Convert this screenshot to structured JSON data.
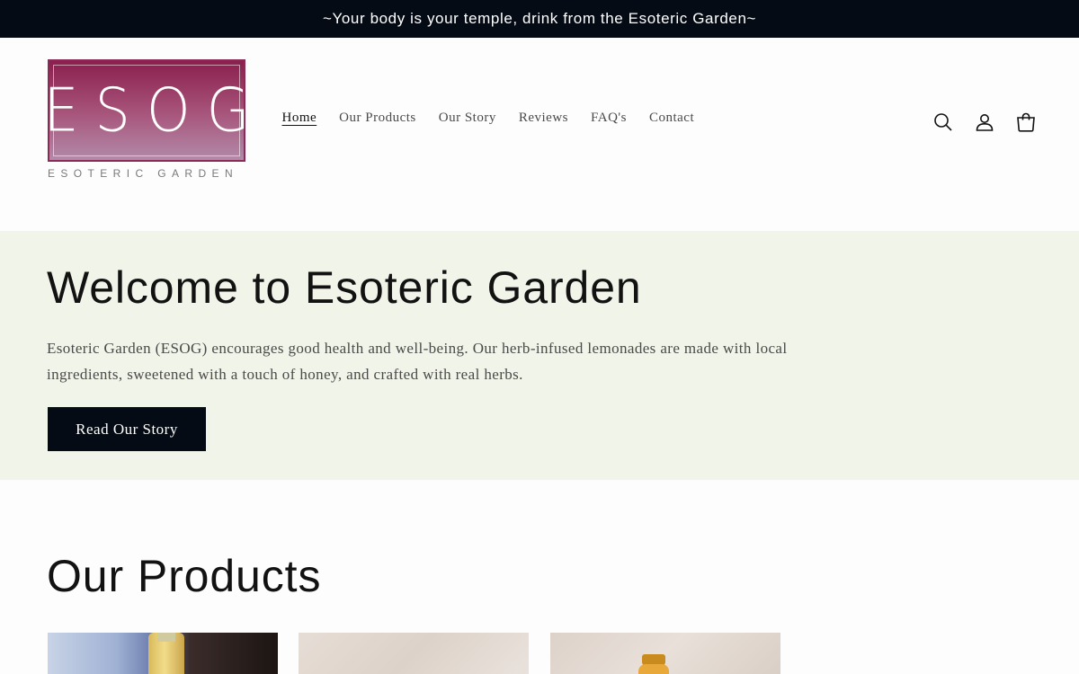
{
  "announcement": {
    "text": "~Your body is your temple, drink from the Esoteric Garden~"
  },
  "brand": {
    "logo_mark": "ESOG",
    "logo_subtitle": "ESOTERIC GARDEN",
    "colors": {
      "logo_top": "#8b1f4d",
      "logo_bottom": "#b28aa9",
      "dark": "#050b14",
      "hero_bg": "#f1f4e8"
    }
  },
  "nav": {
    "items": [
      {
        "label": "Home",
        "active": true
      },
      {
        "label": "Our Products"
      },
      {
        "label": "Our Story"
      },
      {
        "label": "Reviews"
      },
      {
        "label": "FAQ's"
      },
      {
        "label": "Contact"
      }
    ]
  },
  "header_icons": [
    "search-icon",
    "account-icon",
    "cart-icon"
  ],
  "hero": {
    "title": "Welcome to Esoteric Garden",
    "text": "Esoteric Garden (ESOG) encourages good health and well-being. Our herb-infused lemonades are made with local ingredients, sweetened with a touch of honey, and crafted with real herbs.",
    "button_label": "Read Our Story"
  },
  "products": {
    "title": "Our Products"
  }
}
